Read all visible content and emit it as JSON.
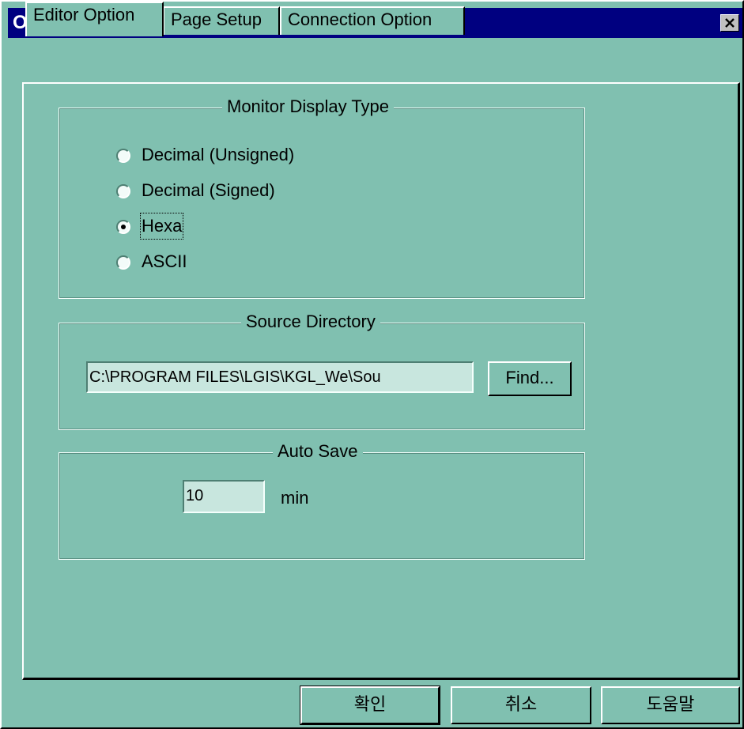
{
  "window": {
    "title": "Options"
  },
  "tabs": [
    {
      "label": "Editor Option",
      "active": true
    },
    {
      "label": "Page Setup",
      "active": false
    },
    {
      "label": "Connection Option",
      "active": false
    }
  ],
  "monitor_display": {
    "label": "Monitor Display Type",
    "options": [
      {
        "label": "Decimal (Unsigned)",
        "selected": false
      },
      {
        "label": "Decimal (Signed)",
        "selected": false
      },
      {
        "label": "Hexa",
        "selected": true
      },
      {
        "label": "ASCII",
        "selected": false
      }
    ]
  },
  "source_directory": {
    "label": "Source Directory",
    "value": "C:\\PROGRAM FILES\\LGIS\\KGL_We\\Sou",
    "find_button": "Find..."
  },
  "auto_save": {
    "label": "Auto Save",
    "value": "10",
    "unit": "min"
  },
  "footer": {
    "ok_button": "확인",
    "cancel_button": "취소",
    "help_button": "도움말"
  }
}
